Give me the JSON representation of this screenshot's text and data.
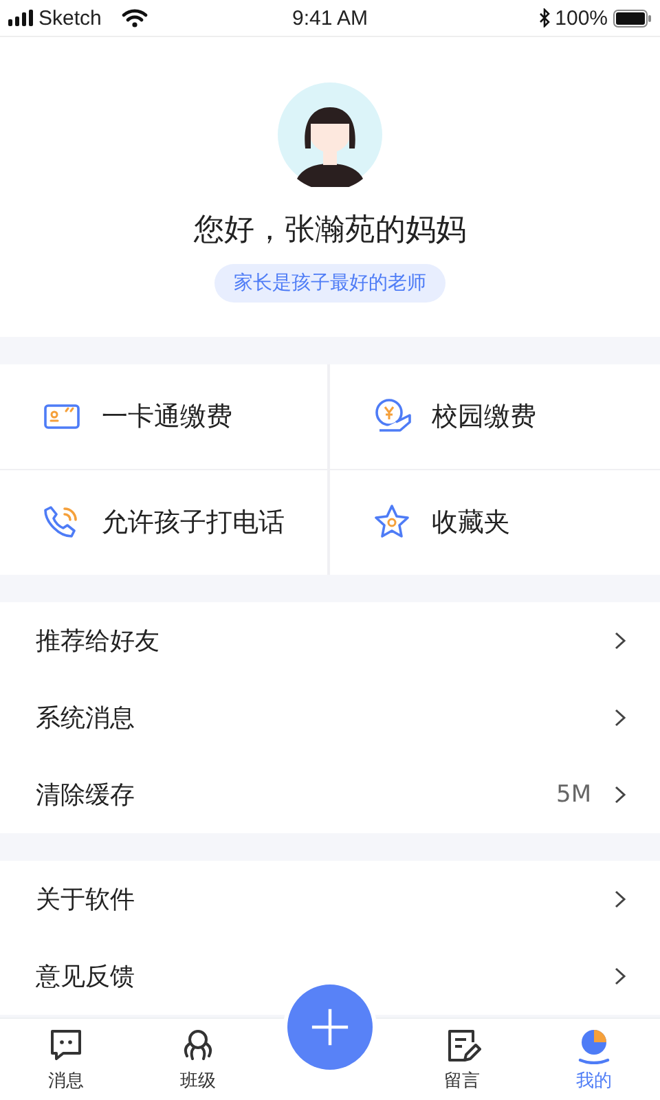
{
  "status_bar": {
    "carrier": "Sketch",
    "time": "9:41 AM",
    "battery": "100%"
  },
  "profile": {
    "greeting": "您好，张瀚苑的妈妈",
    "motto": "家长是孩子最好的老师"
  },
  "shortcuts": [
    {
      "label": "一卡通缴费"
    },
    {
      "label": "校园缴费"
    },
    {
      "label": "允许孩子打电话"
    },
    {
      "label": "收藏夹"
    }
  ],
  "menu_groups": [
    [
      {
        "label": "推荐给好友"
      },
      {
        "label": "系统消息"
      },
      {
        "label": "清除缓存",
        "value": "5M"
      }
    ],
    [
      {
        "label": "关于软件"
      },
      {
        "label": "意见反馈"
      }
    ]
  ],
  "tab_bar": [
    {
      "label": "消息",
      "selected": false
    },
    {
      "label": "班级",
      "selected": false
    },
    {
      "label": "留言",
      "selected": false
    },
    {
      "label": "我的",
      "selected": true
    }
  ]
}
